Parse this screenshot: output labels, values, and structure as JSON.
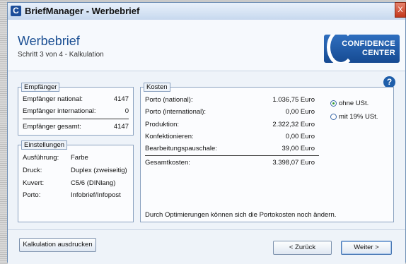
{
  "window": {
    "title": "BriefManager - Werbebrief",
    "icon_letter": "C",
    "close_symbol": "X"
  },
  "header": {
    "title": "Werbebrief",
    "subtitle": "Schritt 3 von 4 - Kalkulation",
    "logo_line1": "CONFIDENCE",
    "logo_line2": "CENTER"
  },
  "help_symbol": "?",
  "empfaenger": {
    "label": "Empfänger",
    "rows": [
      {
        "label": "Empfänger national:",
        "value": "4147"
      },
      {
        "label": "Empfänger international:",
        "value": "0"
      }
    ],
    "total": {
      "label": "Empfänger gesamt:",
      "value": "4147"
    }
  },
  "einstellungen": {
    "label": "Einstellungen",
    "rows": [
      {
        "label": "Ausführung:",
        "value": "Farbe"
      },
      {
        "label": "Druck:",
        "value": "Duplex (zweiseitig)"
      },
      {
        "label": "Kuvert:",
        "value": "C5/6 (DINlang)"
      },
      {
        "label": "Porto:",
        "value": "Infobrief/Infopost"
      }
    ]
  },
  "kosten": {
    "label": "Kosten",
    "rows": [
      {
        "label": "Porto (national):",
        "value": "1.036,75 Euro"
      },
      {
        "label": "Porto (international):",
        "value": "0,00 Euro"
      },
      {
        "label": "Produktion:",
        "value": "2.322,32 Euro"
      },
      {
        "label": "Konfektionieren:",
        "value": "0,00 Euro"
      },
      {
        "label": "Bearbeitungspauschale:",
        "value": "39,00 Euro"
      }
    ],
    "total": {
      "label": "Gesamtkosten:",
      "value": "3.398,07 Euro"
    },
    "tax_options": [
      {
        "label": "ohne USt.",
        "checked": true
      },
      {
        "label": "mit 19% USt.",
        "checked": false
      }
    ],
    "note": "Durch Optimierungen können sich die Portokosten noch ändern."
  },
  "footer": {
    "print_button": "Kalkulation ausdrucken",
    "back_button": "< Zurück",
    "next_button": "Weiter  >"
  }
}
